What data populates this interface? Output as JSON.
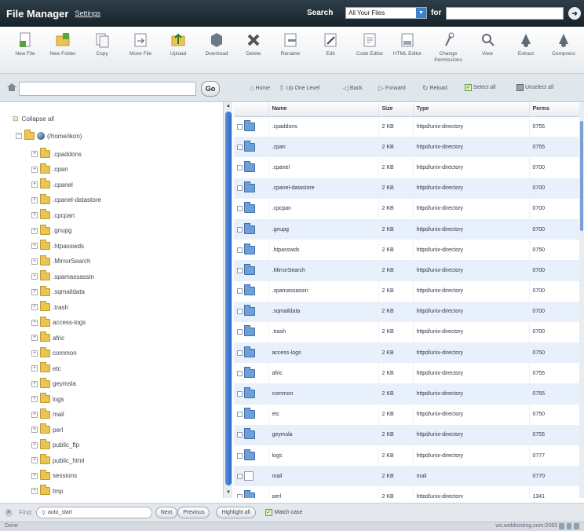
{
  "header": {
    "title": "File Manager",
    "settings_link": "Settings",
    "search_label": "Search",
    "search_scope": "All Your Files",
    "for_label": "for",
    "go_glyph": "Go"
  },
  "toolbar": {
    "buttons": [
      {
        "label": "New File",
        "icon": "new-file-icon"
      },
      {
        "label": "New Folder",
        "icon": "new-folder-icon"
      },
      {
        "label": "Copy",
        "icon": "copy-icon"
      },
      {
        "label": "Move File",
        "icon": "move-file-icon"
      },
      {
        "label": "Upload",
        "icon": "upload-icon"
      },
      {
        "label": "Download",
        "icon": "download-icon"
      },
      {
        "label": "Delete",
        "icon": "delete-icon"
      },
      {
        "label": "Rename",
        "icon": "rename-icon"
      },
      {
        "label": "Edit",
        "icon": "edit-icon"
      },
      {
        "label": "Code Editor",
        "icon": "code-editor-icon"
      },
      {
        "label": "HTML Editor",
        "icon": "html-editor-icon"
      },
      {
        "label": "Change Permissions",
        "icon": "change-permissions-icon"
      },
      {
        "label": "View",
        "icon": "view-icon"
      },
      {
        "label": "Extract",
        "icon": "extract-icon"
      },
      {
        "label": "Compress",
        "icon": "compress-icon"
      }
    ]
  },
  "navbar": {
    "path_value": "",
    "go_label": "Go",
    "home": "Home",
    "up_one_level": "Up One Level",
    "back": "Back",
    "forward": "Forward",
    "reload": "Reload",
    "select_all": "Select all",
    "unselect_all": "Unselect all"
  },
  "tree": {
    "collapse_all": "Collapse all",
    "root": "(/home/ikon)",
    "folders": [
      ".cpaddons",
      ".cpan",
      ".cpanel",
      ".cpanel-datastore",
      ".cpcpan",
      ".gnupg",
      ".htpasswds",
      ".MirrorSearch",
      ".spamassassin",
      ".sqmaildata",
      ".trash",
      "access-logs",
      "afric",
      "common",
      "etc",
      "geymsla",
      "logs",
      "mail",
      "perl",
      "public_ftp",
      "public_html",
      "sessions",
      "tmp"
    ]
  },
  "table": {
    "headers": {
      "name": "Name",
      "size": "Size",
      "type": "Type",
      "perms": "Perms"
    },
    "rows": [
      {
        "name": ".cpaddons",
        "size": "2 KB",
        "type": "httpd/unix-directory",
        "perms": "0755",
        "icon": "folder"
      },
      {
        "name": ".cpan",
        "size": "2 KB",
        "type": "httpd/unix-directory",
        "perms": "0755",
        "icon": "folder"
      },
      {
        "name": ".cpanel",
        "size": "2 KB",
        "type": "httpd/unix-directory",
        "perms": "0700",
        "icon": "folder"
      },
      {
        "name": ".cpanel-datastore",
        "size": "2 KB",
        "type": "httpd/unix-directory",
        "perms": "0700",
        "icon": "folder"
      },
      {
        "name": ".cpcpan",
        "size": "2 KB",
        "type": "httpd/unix-directory",
        "perms": "0700",
        "icon": "folder"
      },
      {
        "name": ".gnupg",
        "size": "2 KB",
        "type": "httpd/unix-directory",
        "perms": "0700",
        "icon": "folder"
      },
      {
        "name": ".htpasswds",
        "size": "2 KB",
        "type": "httpd/unix-directory",
        "perms": "0750",
        "icon": "folder"
      },
      {
        "name": ".MirrorSearch",
        "size": "2 KB",
        "type": "httpd/unix-directory",
        "perms": "0700",
        "icon": "folder"
      },
      {
        "name": ".spamassassin",
        "size": "2 KB",
        "type": "httpd/unix-directory",
        "perms": "0700",
        "icon": "folder"
      },
      {
        "name": ".sqmaildata",
        "size": "2 KB",
        "type": "httpd/unix-directory",
        "perms": "0700",
        "icon": "folder"
      },
      {
        "name": ".trash",
        "size": "2 KB",
        "type": "httpd/unix-directory",
        "perms": "0700",
        "icon": "folder"
      },
      {
        "name": "access-logs",
        "size": "2 KB",
        "type": "httpd/unix-directory",
        "perms": "0750",
        "icon": "folder"
      },
      {
        "name": "afric",
        "size": "2 KB",
        "type": "httpd/unix-directory",
        "perms": "0755",
        "icon": "folder"
      },
      {
        "name": "common",
        "size": "2 KB",
        "type": "httpd/unix-directory",
        "perms": "0755",
        "icon": "folder"
      },
      {
        "name": "etc",
        "size": "2 KB",
        "type": "httpd/unix-directory",
        "perms": "0750",
        "icon": "folder"
      },
      {
        "name": "geymsla",
        "size": "2 KB",
        "type": "httpd/unix-directory",
        "perms": "0755",
        "icon": "folder"
      },
      {
        "name": "logs",
        "size": "2 KB",
        "type": "httpd/unix-directory",
        "perms": "0777",
        "icon": "folder"
      },
      {
        "name": "mail",
        "size": "2 KB",
        "type": "mail",
        "perms": "0770",
        "icon": "mail"
      },
      {
        "name": "perl",
        "size": "2 KB",
        "type": "httpd/unix-directory",
        "perms": "1341",
        "icon": "folder"
      }
    ]
  },
  "findbar": {
    "find_label": "Find:",
    "find_value": "auto_start",
    "next": "Next",
    "previous": "Previous",
    "highlight_all": "Highlight all",
    "match_case": "Match case"
  },
  "statusbar": {
    "left": "Done",
    "right": "ws.webhosting.com:2083"
  },
  "colors": {
    "header_bg": "#17232b",
    "row_alt": "#e8f1fb",
    "folder_blue": "#6f9fd6",
    "folder_yellow": "#e9c653",
    "scroll_thumb": "#2f6bc4"
  }
}
